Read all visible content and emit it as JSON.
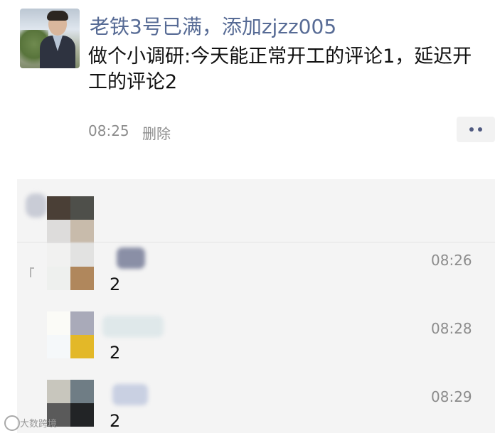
{
  "post": {
    "author": "老铁3号已满，添加zjzz005",
    "text": "做个小调研:今天能正常开工的评论1，延迟开工的评论2",
    "time": "08:25",
    "delete_label": "删除",
    "more_label": "••"
  },
  "comments": [
    {
      "text": "2",
      "time": "08:26"
    },
    {
      "text": "2",
      "time": "08:28"
    },
    {
      "text": "2",
      "time": "08:29"
    }
  ],
  "watermark": {
    "text": "大数跨境"
  },
  "colors": {
    "author": "#576b95",
    "meta": "#8c8c8c",
    "panel": "#f4f4f4"
  }
}
